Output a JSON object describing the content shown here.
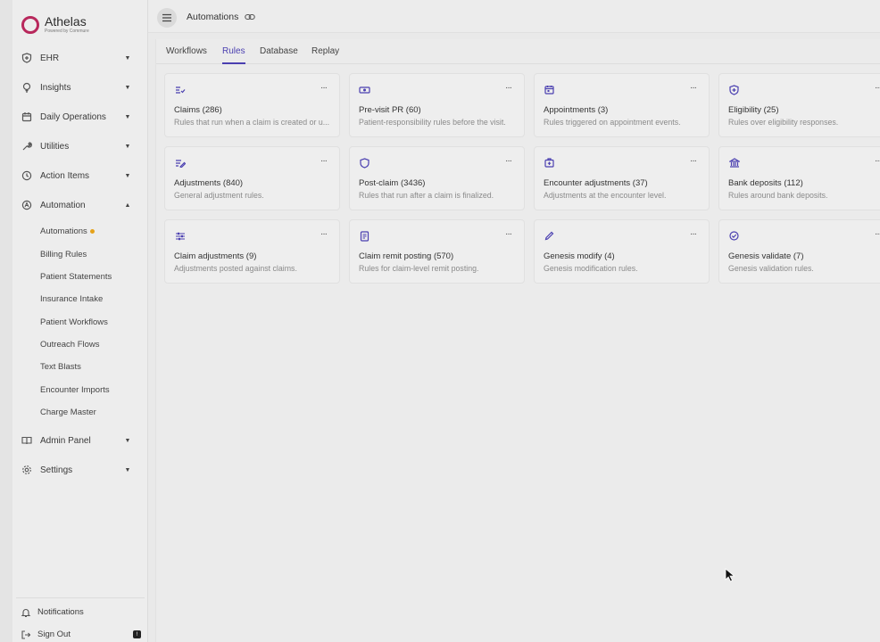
{
  "brand": {
    "name": "Athelas",
    "tagline": "Powered by Commure",
    "accent": "#b8285c"
  },
  "sidebar": {
    "items": [
      {
        "label": "EHR",
        "icon": "shield-plus-icon",
        "expanded": false
      },
      {
        "label": "Insights",
        "icon": "lightbulb-icon",
        "expanded": false
      },
      {
        "label": "Daily Operations",
        "icon": "calendar-icon",
        "expanded": false
      },
      {
        "label": "Utilities",
        "icon": "wrench-icon",
        "expanded": false
      },
      {
        "label": "Action Items",
        "icon": "clock-icon",
        "expanded": false
      },
      {
        "label": "Automation",
        "icon": "automation-icon",
        "expanded": true
      },
      {
        "label": "Admin Panel",
        "icon": "book-icon",
        "expanded": false
      },
      {
        "label": "Settings",
        "icon": "gear-icon",
        "expanded": false
      }
    ],
    "automation_subitems": [
      {
        "label": "Automations",
        "has_dot": true
      },
      {
        "label": "Billing Rules"
      },
      {
        "label": "Patient Statements"
      },
      {
        "label": "Insurance Intake"
      },
      {
        "label": "Patient Workflows"
      },
      {
        "label": "Outreach Flows"
      },
      {
        "label": "Text Blasts"
      },
      {
        "label": "Encounter Imports"
      },
      {
        "label": "Charge Master"
      }
    ],
    "footer": [
      {
        "label": "Notifications",
        "icon": "bell-icon"
      },
      {
        "label": "Sign Out",
        "icon": "sign-out-icon"
      }
    ]
  },
  "header": {
    "title": "Automations"
  },
  "tabs": [
    {
      "label": "Workflows",
      "active": false
    },
    {
      "label": "Rules",
      "active": true
    },
    {
      "label": "Database",
      "active": false
    },
    {
      "label": "Replay",
      "active": false
    }
  ],
  "more_label": "···",
  "cards": [
    {
      "title": "Claims (286)",
      "desc": "Rules that run when a claim is created or u...",
      "icon": "checklist-icon"
    },
    {
      "title": "Pre-visit PR (60)",
      "desc": "Patient-responsibility rules before the visit.",
      "icon": "money-icon"
    },
    {
      "title": "Appointments (3)",
      "desc": "Rules triggered on appointment events.",
      "icon": "calendar-check-icon"
    },
    {
      "title": "Eligibility (25)",
      "desc": "Rules over eligibility responses.",
      "icon": "shield-plus-icon"
    },
    {
      "title": "Adjustments (840)",
      "desc": "General adjustment rules.",
      "icon": "list-edit-icon"
    },
    {
      "title": "Post-claim (3436)",
      "desc": "Rules that run after a claim is finalized.",
      "icon": "shield-icon"
    },
    {
      "title": "Encounter adjustments (37)",
      "desc": "Adjustments at the encounter level.",
      "icon": "medical-bag-icon"
    },
    {
      "title": "Bank deposits (112)",
      "desc": "Rules around bank deposits.",
      "icon": "bank-icon"
    },
    {
      "title": "Claim adjustments (9)",
      "desc": "Adjustments posted against claims.",
      "icon": "sliders-icon"
    },
    {
      "title": "Claim remit posting (570)",
      "desc": "Rules for claim-level remit posting.",
      "icon": "receipt-icon"
    },
    {
      "title": "Genesis modify (4)",
      "desc": "Genesis modification rules.",
      "icon": "pencil-icon"
    },
    {
      "title": "Genesis validate (7)",
      "desc": "Genesis validation rules.",
      "icon": "check-circle-icon"
    }
  ],
  "colors": {
    "accent": "#4a3fb0",
    "dot": "#e5a21a"
  }
}
